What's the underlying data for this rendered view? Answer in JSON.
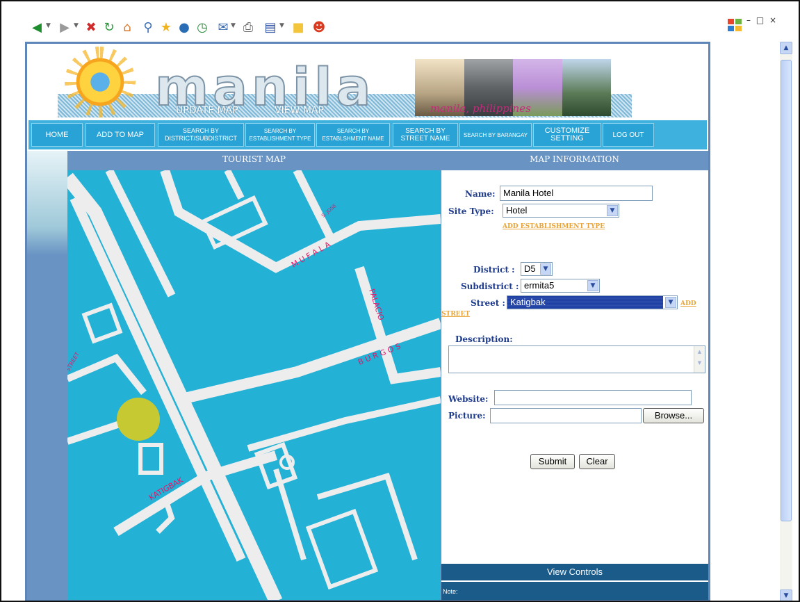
{
  "toolbar": {
    "icons": [
      "back-icon",
      "forward-icon",
      "stop-icon",
      "refresh-icon",
      "home-icon",
      "search-icon",
      "favorites-icon",
      "media-icon",
      "history-icon",
      "mail-icon",
      "print-icon",
      "edit-icon",
      "messenger-icon"
    ]
  },
  "banner": {
    "logo": "manila",
    "update_map": "UPDATE MAP",
    "view_map": "VIEW MAP",
    "caption": "manila, philippines"
  },
  "nav": [
    {
      "id": "home",
      "lines": [
        "HOME"
      ]
    },
    {
      "id": "add-to-map",
      "lines": [
        "ADD TO MAP"
      ]
    },
    {
      "id": "search-district",
      "lines": [
        "SEARCH BY",
        "DISTRICT/SUBDISTRICT"
      ]
    },
    {
      "id": "search-establishment-type",
      "lines": [
        "SEARCH BY",
        "ESTABLISHMENT TYPE"
      ]
    },
    {
      "id": "search-establishment-name",
      "lines": [
        "SEARCH BY",
        "ESTABLSHMENT NAME"
      ]
    },
    {
      "id": "search-street",
      "lines": [
        "SEARCH  BY",
        "STREET NAME"
      ]
    },
    {
      "id": "search-barangay",
      "lines": [
        "SEARCH BY BARANGAY"
      ]
    },
    {
      "id": "customize-setting",
      "lines": [
        "CUSTOMIZE",
        "SETTING"
      ]
    },
    {
      "id": "log-out",
      "lines": [
        "LOG OUT"
      ]
    }
  ],
  "map": {
    "header": "TOURIST MAP",
    "streets": {
      "mufala": "M U F A L A",
      "palacio": "PALACIO",
      "burgos": "B U R G O S",
      "katigbak": "KATIGBAK",
      "street": "STREET",
      "jose": "S. JOSE"
    }
  },
  "info": {
    "header": "MAP INFORMATION",
    "name_label": "Name:",
    "name_value": "Manila Hotel",
    "site_type_label": "Site Type:",
    "site_type_value": "Hotel",
    "add_establishment_type": "ADD ESTABLISHMENT TYPE",
    "district_label": "District :",
    "district_value": "D5",
    "subdistrict_label": "Subdistrict :",
    "subdistrict_value": "ermita5",
    "street_label": "Street :",
    "street_value": "Katigbak",
    "add_street_1": "ADD",
    "add_street_2": "STREET",
    "description_label": "Description:",
    "description_value": "",
    "website_label": "Website:",
    "website_value": "",
    "picture_label": "Picture:",
    "picture_value": "",
    "browse": "Browse...",
    "submit": "Submit",
    "clear": "Clear",
    "view_controls": "View Controls",
    "note": "Note:"
  },
  "colors": {
    "nav_bg": "#3fb1de",
    "header_bg": "#6993c3",
    "map_water": "#24b1d6",
    "map_road": "#eeeeee",
    "marker": "#c7c933",
    "controls_bg": "#1b5b89"
  }
}
